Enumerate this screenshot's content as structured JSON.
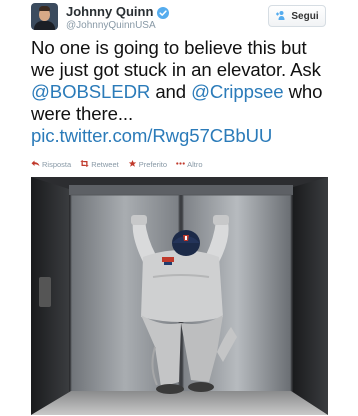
{
  "author": {
    "display_name": "Johnny Quinn",
    "handle": "@JohnnyQuinnUSA",
    "verified": true
  },
  "follow_button": {
    "label": "Segui",
    "icon": "follow-user-icon"
  },
  "tweet": {
    "line1": "No one is going to believe this but",
    "line2": "we just got stuck in an elevator. Ask",
    "mention1": "@BOBSLEDR",
    "and_word": " and ",
    "mention2": "@Crippsee",
    "who_word": " who",
    "line4": "were there...",
    "link": "pic.twitter.com/Rwg57CBbUU"
  },
  "actions": [
    {
      "label": "Risposta",
      "icon": "reply-icon"
    },
    {
      "label": "Retweet",
      "icon": "retweet-icon"
    },
    {
      "label": "Preferito",
      "icon": "star-icon"
    },
    {
      "label": "Altro",
      "icon": "more-icon"
    }
  ],
  "colors": {
    "link": "#2b7bb9",
    "muted": "#8899a6",
    "verified": "#55acee"
  }
}
